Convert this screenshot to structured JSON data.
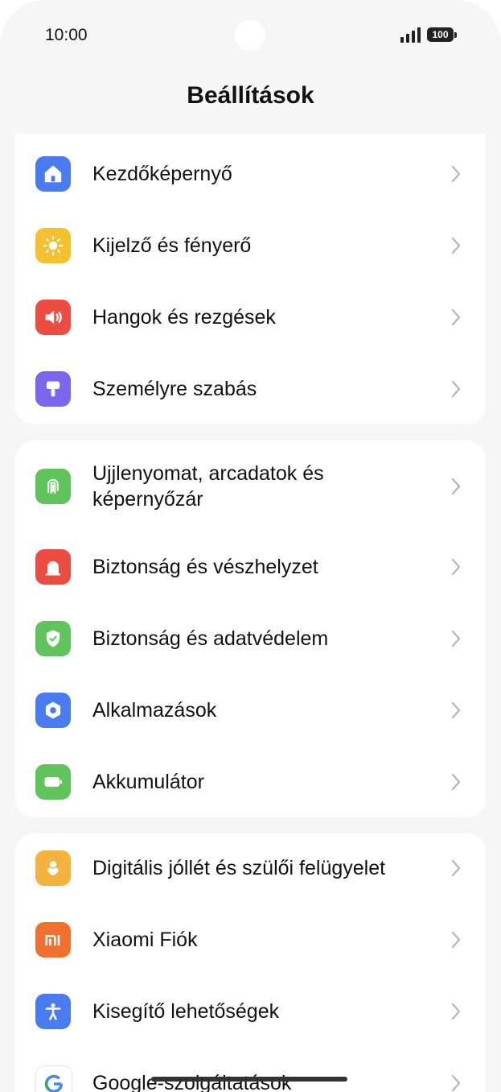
{
  "status_bar": {
    "time": "10:00",
    "battery": "100"
  },
  "header": {
    "title": "Beállítások"
  },
  "groups": [
    {
      "items": [
        {
          "label": "Kezdőképernyő",
          "icon": "home-icon",
          "color": "#4a7bf0"
        },
        {
          "label": "Kijelző és fényerő",
          "icon": "sun-icon",
          "color": "#f4c02e"
        },
        {
          "label": "Hangok és rezgések",
          "icon": "speaker-icon",
          "color": "#ec4c42"
        },
        {
          "label": "Személyre szabás",
          "icon": "paint-brush-icon",
          "color": "#7b66ee"
        }
      ]
    },
    {
      "items": [
        {
          "label": "Ujjlenyomat, arcadatok és képernyőzár",
          "icon": "fingerprint-icon",
          "color": "#5ec45b"
        },
        {
          "label": "Biztonság és vészhelyzet",
          "icon": "emergency-light-icon",
          "color": "#ec4c42"
        },
        {
          "label": "Biztonság és adatvédelem",
          "icon": "shield-check-icon",
          "color": "#5ec45b"
        },
        {
          "label": "Alkalmazások",
          "icon": "hexagon-gear-icon",
          "color": "#4a7bf0"
        },
        {
          "label": "Akkumulátor",
          "icon": "battery-icon",
          "color": "#5ec45b"
        }
      ]
    },
    {
      "items": [
        {
          "label": "Digitális jóllét és szülői felügyelet",
          "icon": "person-heart-icon",
          "color": "#f4b23e"
        },
        {
          "label": "Xiaomi Fiók",
          "icon": "mi-logo-icon",
          "color": "#f07030"
        },
        {
          "label": "Kisegítő lehetőségek",
          "icon": "accessibility-icon",
          "color": "#4a7bf0"
        },
        {
          "label": "Google-szolgáltatások",
          "icon": "google-logo-icon",
          "color": "#ffffff"
        }
      ]
    }
  ]
}
